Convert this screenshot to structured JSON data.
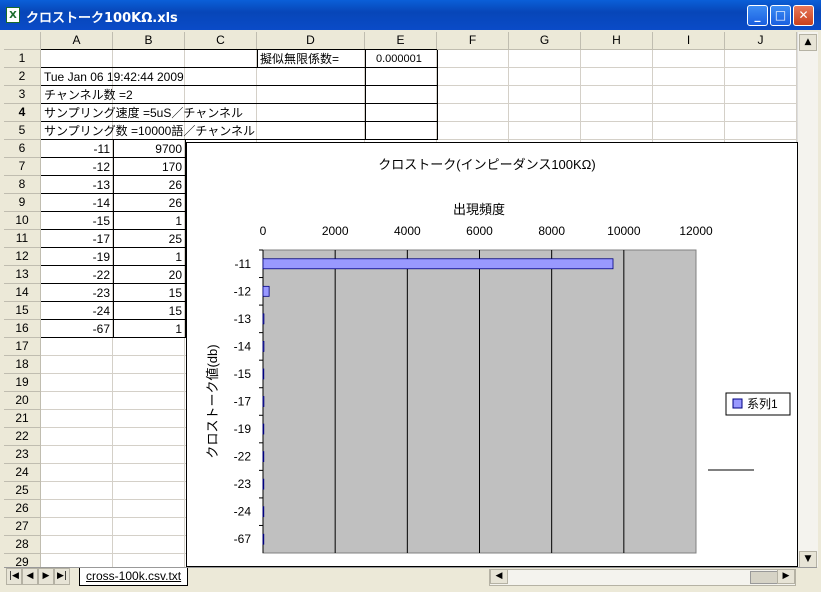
{
  "window": {
    "title": "クロストーク100KΩ.xls",
    "app_icon": "excel-icon"
  },
  "buttons": {
    "minimize": "_",
    "maximize": "□",
    "close": "✕"
  },
  "columns": [
    "A",
    "B",
    "C",
    "D",
    "E",
    "F",
    "G",
    "H",
    "I",
    "J"
  ],
  "rows": [
    "1",
    "2",
    "3",
    "4",
    "5",
    "6",
    "7",
    "8",
    "9",
    "10",
    "11",
    "12",
    "13",
    "14",
    "15",
    "16",
    "17",
    "18",
    "19",
    "20",
    "21",
    "22",
    "23",
    "24",
    "25",
    "26",
    "27",
    "28",
    "29"
  ],
  "cells": {
    "d1": "擬似無限係数=",
    "e1": "0.000001",
    "a2": "Tue Jan 06 19:42:44 2009",
    "a3": "チャンネル数 =2",
    "a4": "サンプリング速度 =5uS／チャンネル",
    "a5": "サンプリング数 =10000語／チャンネル"
  },
  "table": [
    {
      "a": "-11",
      "b": "9700"
    },
    {
      "a": "-12",
      "b": "170"
    },
    {
      "a": "-13",
      "b": "26"
    },
    {
      "a": "-14",
      "b": "26"
    },
    {
      "a": "-15",
      "b": "1"
    },
    {
      "a": "-17",
      "b": "25"
    },
    {
      "a": "-19",
      "b": "1"
    },
    {
      "a": "-22",
      "b": "20"
    },
    {
      "a": "-23",
      "b": "15"
    },
    {
      "a": "-24",
      "b": "15"
    },
    {
      "a": "-67",
      "b": "1"
    }
  ],
  "sheet_tab": "cross-100k.csv.txt",
  "nav_arrows": [
    "|◀",
    "◀",
    "▶",
    "▶|"
  ],
  "chart_data": {
    "type": "bar",
    "orientation": "horizontal",
    "title": "クロストーク(インピーダンス100KΩ)",
    "xlabel": "出現頻度",
    "ylabel": "クロストーク値(db)",
    "categories": [
      "-11",
      "-12",
      "-13",
      "-14",
      "-15",
      "-17",
      "-19",
      "-22",
      "-23",
      "-24",
      "-67"
    ],
    "series": [
      {
        "name": "系列1",
        "values": [
          9700,
          170,
          26,
          26,
          1,
          25,
          1,
          20,
          15,
          15,
          1
        ],
        "color": "#9999ff"
      }
    ],
    "xlim": [
      0,
      12000
    ],
    "xticks": [
      "0",
      "2000",
      "4000",
      "6000",
      "8000",
      "10000",
      "12000"
    ],
    "x_axis_position": "top",
    "plot_background": "#c0c0c0",
    "grid": true,
    "legend_position": "right"
  }
}
